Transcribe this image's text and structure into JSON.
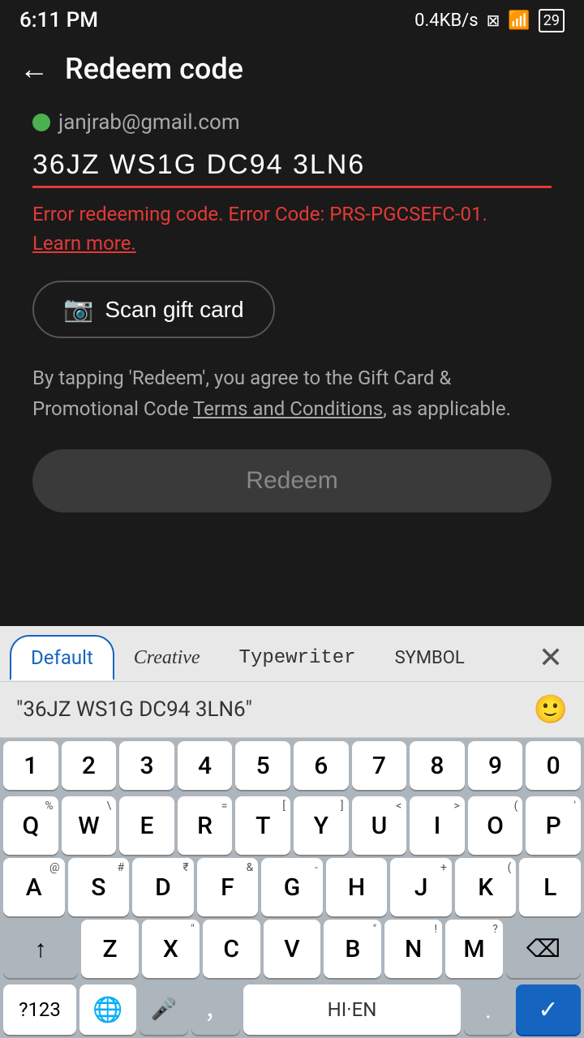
{
  "statusBar": {
    "time": "6:11 PM",
    "network": "0.4KB/s",
    "batteryLevel": "29"
  },
  "header": {
    "title": "Redeem code",
    "backLabel": "←"
  },
  "email": {
    "address": "janjrab@gmail.com"
  },
  "codeInput": {
    "value": "36JZ WS1G DC94 3LN6"
  },
  "error": {
    "message": "Error redeeming code. Error Code: PRS-PGCSEFC-01.",
    "learnMore": "Learn more."
  },
  "scanBtn": {
    "label": "Scan gift card"
  },
  "terms": {
    "text1": "By tapping 'Redeem', you agree to the Gift Card & Promotional Code ",
    "linkText": "Terms and Conditions",
    "text2": ", as applicable."
  },
  "redeemBtn": {
    "label": "Redeem"
  },
  "keyboard": {
    "tabs": [
      {
        "label": "Default",
        "active": true,
        "style": "default"
      },
      {
        "label": "Creative",
        "active": false,
        "style": "creative"
      },
      {
        "label": "Typewriter",
        "active": false,
        "style": "typewriter"
      },
      {
        "label": "SYMBOL",
        "active": false,
        "style": "symbol"
      }
    ],
    "clipboardText": "\"36JZ WS1G DC94 3LN6\"",
    "numbers": [
      "1",
      "2",
      "3",
      "4",
      "5",
      "6",
      "7",
      "8",
      "9",
      "0"
    ],
    "row1": [
      "Q",
      "W",
      "E",
      "R",
      "T",
      "Y",
      "U",
      "I",
      "O",
      "P"
    ],
    "row1Subs": [
      "%",
      "\\",
      "",
      "=",
      "[",
      "]",
      "<",
      ">",
      "(",
      "'"
    ],
    "row2": [
      "A",
      "S",
      "D",
      "F",
      "G",
      "H",
      "J",
      "K",
      "L"
    ],
    "row2Subs": [
      "@",
      "#",
      "₹",
      "&",
      "-",
      "",
      "+",
      "(",
      ""
    ],
    "row3": [
      "Z",
      "X",
      "C",
      "V",
      "B",
      "N",
      "M"
    ],
    "row3Subs": [
      "",
      "\"",
      "",
      "",
      "\"",
      "!",
      "?"
    ],
    "spaceLabel": "HI·EN",
    "sym123": "?123",
    "period": ".",
    "comma": ","
  }
}
